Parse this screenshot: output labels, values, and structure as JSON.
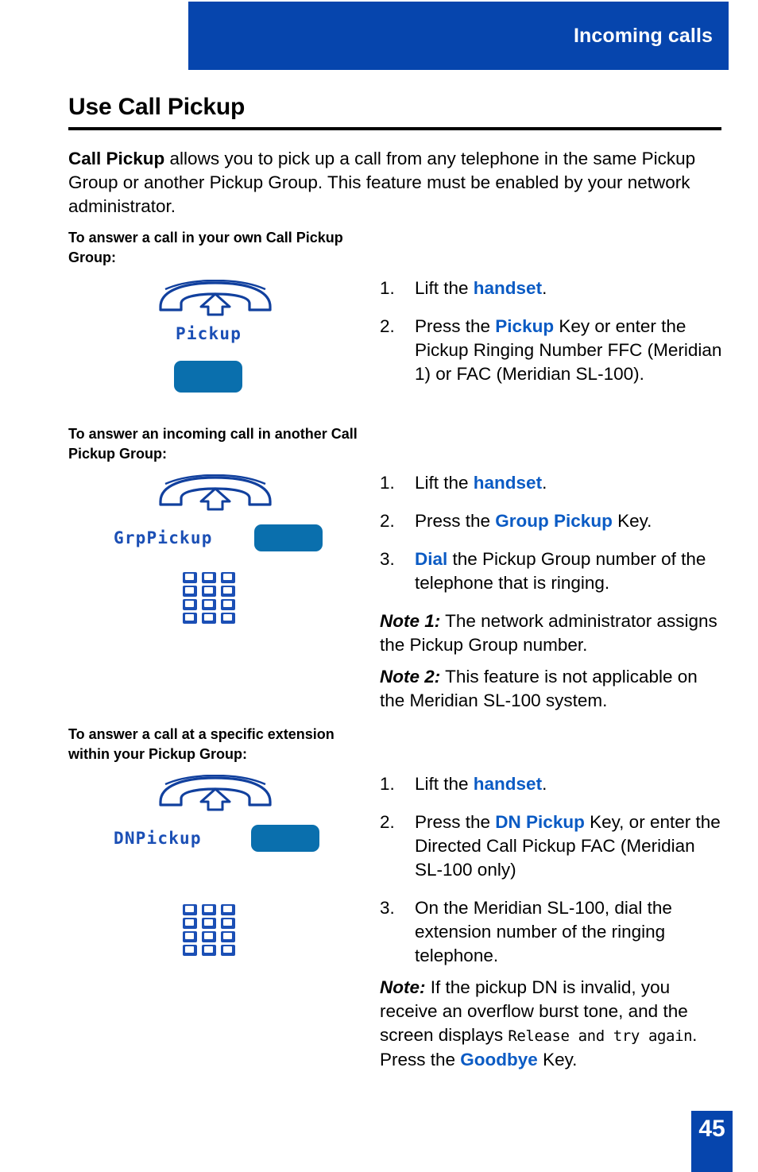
{
  "header": {
    "title": "Incoming calls",
    "band_color": "#0645AD"
  },
  "page": {
    "title": "Use Call Pickup",
    "number": "45"
  },
  "intro": {
    "lead": "Call Pickup",
    "body": " allows you to pick up a call from any telephone in the same Pickup Group or another Pickup Group. This feature must be enabled by your network administrator."
  },
  "sections": [
    {
      "caption": "To answer a call in your own Call Pickup Group:",
      "icons": {
        "handset": "lift-handset-icon",
        "softkey_label": "Pickup",
        "softkey": "soft-key-button"
      },
      "steps": [
        {
          "num": "1.",
          "pre": "Lift the ",
          "key": "handset",
          "post": "."
        },
        {
          "num": "2.",
          "pre": "Press the ",
          "key": "Pickup",
          "post": " Key or enter the Pickup Ringing Number FFC (Meridian 1) or FAC (Meridian SL-100)."
        }
      ],
      "notes": []
    },
    {
      "caption": "To answer an incoming call in another Call Pickup Group:",
      "icons": {
        "handset": "lift-handset-icon",
        "softkey_label": "GrpPickup",
        "softkey": "soft-key-button",
        "keypad": "dial-keypad-icon"
      },
      "steps": [
        {
          "num": "1.",
          "pre": "Lift the ",
          "key": "handset",
          "post": "."
        },
        {
          "num": "2.",
          "pre": "Press the ",
          "key": "Group Pickup",
          "post": " Key."
        },
        {
          "num": "3.",
          "pre": "",
          "key": "Dial",
          "post": " the Pickup Group number of the telephone that is ringing."
        }
      ],
      "notes": [
        {
          "label": "Note 1:",
          "text": "  The network administrator assigns the Pickup Group number."
        },
        {
          "label": "Note 2:",
          "text": "   This feature is not applicable on the Meridian SL-100 system."
        }
      ]
    },
    {
      "caption": "To answer a call at a specific extension within your Pickup Group:",
      "icons": {
        "handset": "lift-handset-icon",
        "softkey_label": "DNPickup",
        "softkey": "soft-key-button",
        "keypad": "dial-keypad-icon"
      },
      "steps": [
        {
          "num": "1.",
          "pre": "Lift the ",
          "key": "handset",
          "post": "."
        },
        {
          "num": "2.",
          "pre": "Press the ",
          "key": "DN Pickup",
          "post": " Key, or enter the Directed Call Pickup FAC (Meridian SL-100 only)"
        },
        {
          "num": "3.",
          "pre": "On the Meridian SL-100, dial the extension number of the ringing telephone.",
          "key": "",
          "post": ""
        }
      ],
      "notes": [
        {
          "label": "Note:",
          "text": " If the pickup DN is invalid, you receive an overflow burst tone, and the screen displays ",
          "lcd": "Release and try again",
          "tail_pre": ". Press the ",
          "tail_key": "Goodbye",
          "tail_post": " Key."
        }
      ]
    }
  ],
  "colors": {
    "brand_blue": "#0645AD",
    "softkey_blue": "#0A6FAD",
    "accent_text_blue": "#0B5BC4",
    "lcd_blue": "#1B4FB5"
  }
}
